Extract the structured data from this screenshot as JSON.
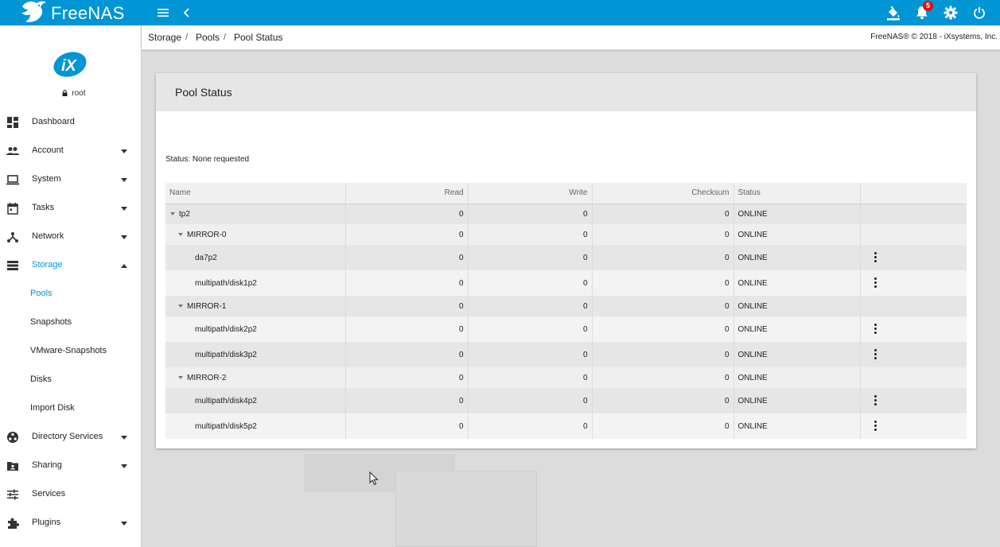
{
  "app": {
    "logo_text": "FreeNAS",
    "brand_color": "#0095d5",
    "notification_count": "5"
  },
  "topbar": {
    "icons": [
      "menu-icon",
      "chevron-left-icon",
      "paint-bucket-icon",
      "bell-icon",
      "gear-icon",
      "power-icon"
    ]
  },
  "user": {
    "name": "root"
  },
  "sidebar": {
    "items": [
      {
        "label": "Dashboard",
        "icon": "dashboard-icon"
      },
      {
        "label": "Account",
        "icon": "people-icon"
      },
      {
        "label": "System",
        "icon": "laptop-icon"
      },
      {
        "label": "Tasks",
        "icon": "calendar-icon"
      },
      {
        "label": "Network",
        "icon": "network-icon"
      },
      {
        "label": "Storage",
        "icon": "storage-icon"
      },
      {
        "label": "Directory Services",
        "icon": "directory-icon"
      },
      {
        "label": "Sharing",
        "icon": "sharing-icon"
      },
      {
        "label": "Services",
        "icon": "tune-icon"
      },
      {
        "label": "Plugins",
        "icon": "puzzle-icon"
      }
    ],
    "storage_sub": [
      "Pools",
      "Snapshots",
      "VMware-Snapshots",
      "Disks",
      "Import Disk"
    ]
  },
  "breadcrumb": {
    "items": [
      "Storage",
      "Pools",
      "Pool Status"
    ],
    "copyright": "FreeNAS® © 2018 - iXsystems, Inc."
  },
  "card": {
    "title": "Pool Status",
    "scrub_status": "Status: None requested"
  },
  "table": {
    "headers": [
      "Name",
      "Read",
      "Write",
      "Checksum",
      "Status",
      ""
    ],
    "rows": [
      {
        "name": "tp2",
        "read": "0",
        "write": "0",
        "checksum": "0",
        "status": "ONLINE"
      },
      {
        "name": "MIRROR-0",
        "read": "0",
        "write": "0",
        "checksum": "0",
        "status": "ONLINE"
      },
      {
        "name": "da7p2",
        "read": "0",
        "write": "0",
        "checksum": "0",
        "status": "ONLINE"
      },
      {
        "name": "multipath/disk1p2",
        "read": "0",
        "write": "0",
        "checksum": "0",
        "status": "ONLINE"
      },
      {
        "name": "MIRROR-1",
        "read": "0",
        "write": "0",
        "checksum": "0",
        "status": "ONLINE"
      },
      {
        "name": "multipath/disk2p2",
        "read": "0",
        "write": "0",
        "checksum": "0",
        "status": "ONLINE"
      },
      {
        "name": "multipath/disk3p2",
        "read": "0",
        "write": "0",
        "checksum": "0",
        "status": "ONLINE"
      },
      {
        "name": "MIRROR-2",
        "read": "0",
        "write": "0",
        "checksum": "0",
        "status": "ONLINE"
      },
      {
        "name": "multipath/disk4p2",
        "read": "0",
        "write": "0",
        "checksum": "0",
        "status": "ONLINE"
      },
      {
        "name": "multipath/disk5p2",
        "read": "0",
        "write": "0",
        "checksum": "0",
        "status": "ONLINE"
      }
    ]
  }
}
